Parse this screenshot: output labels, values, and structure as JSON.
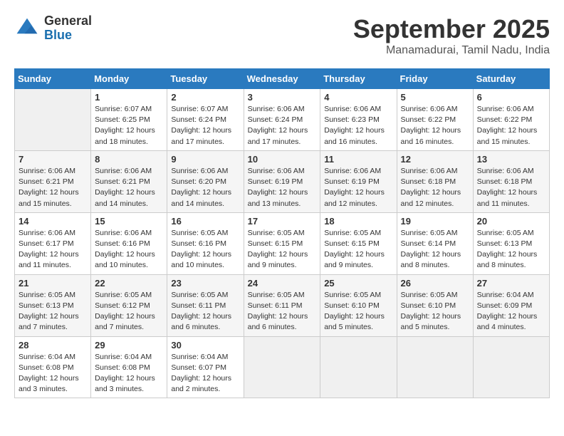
{
  "header": {
    "logo": {
      "line1": "General",
      "line2": "Blue"
    },
    "title": "September 2025",
    "location": "Manamadurai, Tamil Nadu, India"
  },
  "days_of_week": [
    "Sunday",
    "Monday",
    "Tuesday",
    "Wednesday",
    "Thursday",
    "Friday",
    "Saturday"
  ],
  "weeks": [
    [
      {
        "day": "",
        "info": ""
      },
      {
        "day": "1",
        "info": "Sunrise: 6:07 AM\nSunset: 6:25 PM\nDaylight: 12 hours\nand 18 minutes."
      },
      {
        "day": "2",
        "info": "Sunrise: 6:07 AM\nSunset: 6:24 PM\nDaylight: 12 hours\nand 17 minutes."
      },
      {
        "day": "3",
        "info": "Sunrise: 6:06 AM\nSunset: 6:24 PM\nDaylight: 12 hours\nand 17 minutes."
      },
      {
        "day": "4",
        "info": "Sunrise: 6:06 AM\nSunset: 6:23 PM\nDaylight: 12 hours\nand 16 minutes."
      },
      {
        "day": "5",
        "info": "Sunrise: 6:06 AM\nSunset: 6:22 PM\nDaylight: 12 hours\nand 16 minutes."
      },
      {
        "day": "6",
        "info": "Sunrise: 6:06 AM\nSunset: 6:22 PM\nDaylight: 12 hours\nand 15 minutes."
      }
    ],
    [
      {
        "day": "7",
        "info": "Sunrise: 6:06 AM\nSunset: 6:21 PM\nDaylight: 12 hours\nand 15 minutes."
      },
      {
        "day": "8",
        "info": "Sunrise: 6:06 AM\nSunset: 6:21 PM\nDaylight: 12 hours\nand 14 minutes."
      },
      {
        "day": "9",
        "info": "Sunrise: 6:06 AM\nSunset: 6:20 PM\nDaylight: 12 hours\nand 14 minutes."
      },
      {
        "day": "10",
        "info": "Sunrise: 6:06 AM\nSunset: 6:19 PM\nDaylight: 12 hours\nand 13 minutes."
      },
      {
        "day": "11",
        "info": "Sunrise: 6:06 AM\nSunset: 6:19 PM\nDaylight: 12 hours\nand 12 minutes."
      },
      {
        "day": "12",
        "info": "Sunrise: 6:06 AM\nSunset: 6:18 PM\nDaylight: 12 hours\nand 12 minutes."
      },
      {
        "day": "13",
        "info": "Sunrise: 6:06 AM\nSunset: 6:18 PM\nDaylight: 12 hours\nand 11 minutes."
      }
    ],
    [
      {
        "day": "14",
        "info": "Sunrise: 6:06 AM\nSunset: 6:17 PM\nDaylight: 12 hours\nand 11 minutes."
      },
      {
        "day": "15",
        "info": "Sunrise: 6:06 AM\nSunset: 6:16 PM\nDaylight: 12 hours\nand 10 minutes."
      },
      {
        "day": "16",
        "info": "Sunrise: 6:05 AM\nSunset: 6:16 PM\nDaylight: 12 hours\nand 10 minutes."
      },
      {
        "day": "17",
        "info": "Sunrise: 6:05 AM\nSunset: 6:15 PM\nDaylight: 12 hours\nand 9 minutes."
      },
      {
        "day": "18",
        "info": "Sunrise: 6:05 AM\nSunset: 6:15 PM\nDaylight: 12 hours\nand 9 minutes."
      },
      {
        "day": "19",
        "info": "Sunrise: 6:05 AM\nSunset: 6:14 PM\nDaylight: 12 hours\nand 8 minutes."
      },
      {
        "day": "20",
        "info": "Sunrise: 6:05 AM\nSunset: 6:13 PM\nDaylight: 12 hours\nand 8 minutes."
      }
    ],
    [
      {
        "day": "21",
        "info": "Sunrise: 6:05 AM\nSunset: 6:13 PM\nDaylight: 12 hours\nand 7 minutes."
      },
      {
        "day": "22",
        "info": "Sunrise: 6:05 AM\nSunset: 6:12 PM\nDaylight: 12 hours\nand 7 minutes."
      },
      {
        "day": "23",
        "info": "Sunrise: 6:05 AM\nSunset: 6:11 PM\nDaylight: 12 hours\nand 6 minutes."
      },
      {
        "day": "24",
        "info": "Sunrise: 6:05 AM\nSunset: 6:11 PM\nDaylight: 12 hours\nand 6 minutes."
      },
      {
        "day": "25",
        "info": "Sunrise: 6:05 AM\nSunset: 6:10 PM\nDaylight: 12 hours\nand 5 minutes."
      },
      {
        "day": "26",
        "info": "Sunrise: 6:05 AM\nSunset: 6:10 PM\nDaylight: 12 hours\nand 5 minutes."
      },
      {
        "day": "27",
        "info": "Sunrise: 6:04 AM\nSunset: 6:09 PM\nDaylight: 12 hours\nand 4 minutes."
      }
    ],
    [
      {
        "day": "28",
        "info": "Sunrise: 6:04 AM\nSunset: 6:08 PM\nDaylight: 12 hours\nand 3 minutes."
      },
      {
        "day": "29",
        "info": "Sunrise: 6:04 AM\nSunset: 6:08 PM\nDaylight: 12 hours\nand 3 minutes."
      },
      {
        "day": "30",
        "info": "Sunrise: 6:04 AM\nSunset: 6:07 PM\nDaylight: 12 hours\nand 2 minutes."
      },
      {
        "day": "",
        "info": ""
      },
      {
        "day": "",
        "info": ""
      },
      {
        "day": "",
        "info": ""
      },
      {
        "day": "",
        "info": ""
      }
    ]
  ]
}
